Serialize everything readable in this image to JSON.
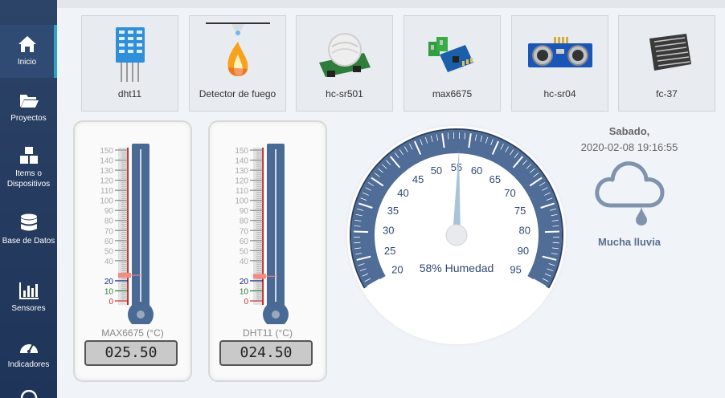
{
  "sidebar": {
    "items": [
      {
        "label": "Inicio",
        "icon": "home-icon",
        "active": true
      },
      {
        "label": "Proyectos",
        "icon": "folder-icon"
      },
      {
        "label": "Items o Dispositivos",
        "icon": "cubes-icon"
      },
      {
        "label": "Base de Datos",
        "icon": "database-icon"
      },
      {
        "label": "Sensores",
        "icon": "bar-chart-icon"
      },
      {
        "label": "Indicadores",
        "icon": "dashboard-icon"
      }
    ]
  },
  "sensors": [
    {
      "label": "dht11",
      "icon": "dht11-sensor-icon"
    },
    {
      "label": "Detector de fuego",
      "icon": "fire-detector-icon"
    },
    {
      "label": "hc-sr501",
      "icon": "pir-sensor-icon"
    },
    {
      "label": "max6675",
      "icon": "thermocouple-module-icon"
    },
    {
      "label": "hc-sr04",
      "icon": "ultrasonic-sensor-icon"
    },
    {
      "label": "fc-37",
      "icon": "rain-sensor-icon"
    }
  ],
  "thermometers": [
    {
      "name": "MAX6675 (°C)",
      "display": "025.50",
      "value": 25.5
    },
    {
      "name": "DHT11 (°C)",
      "display": "024.50",
      "value": 24.5
    }
  ],
  "thermometer_scale": {
    "ticks": [
      "150",
      "140",
      "130",
      "120",
      "110",
      "100",
      "90",
      "80",
      "70",
      "60",
      "50",
      "40",
      "20",
      "10",
      "0"
    ],
    "max": 150,
    "colors": {
      "low": "#d32f2f",
      "mid": "#2e7d32",
      "high": "#1a237e",
      "tube": "#4a6a96"
    }
  },
  "gauge": {
    "label": "58% Humedad",
    "value": 58,
    "min": 20,
    "max": 95,
    "ticks": [
      "20",
      "25",
      "30",
      "35",
      "40",
      "45",
      "50",
      "55",
      "60",
      "65",
      "70",
      "75",
      "80",
      "90",
      "95"
    ],
    "color": "#4f6d96"
  },
  "weather": {
    "day": "Sabado,",
    "datetime": "2020-02-08 19:16:55",
    "status": "Mucha lluvia",
    "icon": "rain-cloud-icon"
  }
}
